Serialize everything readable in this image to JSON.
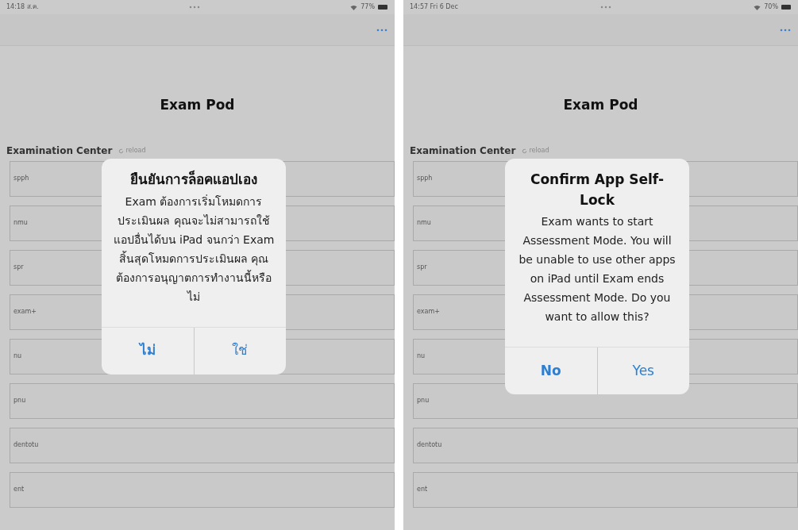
{
  "panels": [
    {
      "status_bar": {
        "time": "14:18 ส.ค.",
        "battery": "77%"
      },
      "title": "Exam Pod",
      "section": {
        "label": "Examination Center",
        "action": "reload"
      },
      "centers": [
        "spph",
        "nmu",
        "spr",
        "exam+",
        "nu",
        "pnu",
        "dentotu",
        "ent"
      ],
      "dialog": {
        "title": "ยืนยันการล็อคแอปเอง",
        "message": "Exam ต้องการเริ่มโหมดการประเมินผล คุณจะไม่สามารถใช้แอปอื่นได้บน iPad จนกว่า Exam สิ้นสุดโหมดการประเมินผล คุณต้องการอนุญาตการทำงานนี้หรือไม่",
        "buttons": [
          {
            "label": "ไม่",
            "kind": "cancel"
          },
          {
            "label": "ใช่",
            "kind": "default"
          }
        ]
      }
    },
    {
      "status_bar": {
        "time": "14:57 Fri 6 Dec",
        "battery": "70%"
      },
      "title": "Exam Pod",
      "section": {
        "label": "Examination Center",
        "action": "reload"
      },
      "centers": [
        "spph",
        "nmu",
        "spr",
        "exam+",
        "nu",
        "pnu",
        "dentotu",
        "ent"
      ],
      "dialog": {
        "title": "Confirm App Self-Lock",
        "message": "Exam wants to start Assessment Mode. You will be unable to use other apps on iPad until Exam ends Assessment Mode. Do you want to allow this?",
        "buttons": [
          {
            "label": "No",
            "kind": "cancel"
          },
          {
            "label": "Yes",
            "kind": "default"
          }
        ]
      }
    }
  ]
}
